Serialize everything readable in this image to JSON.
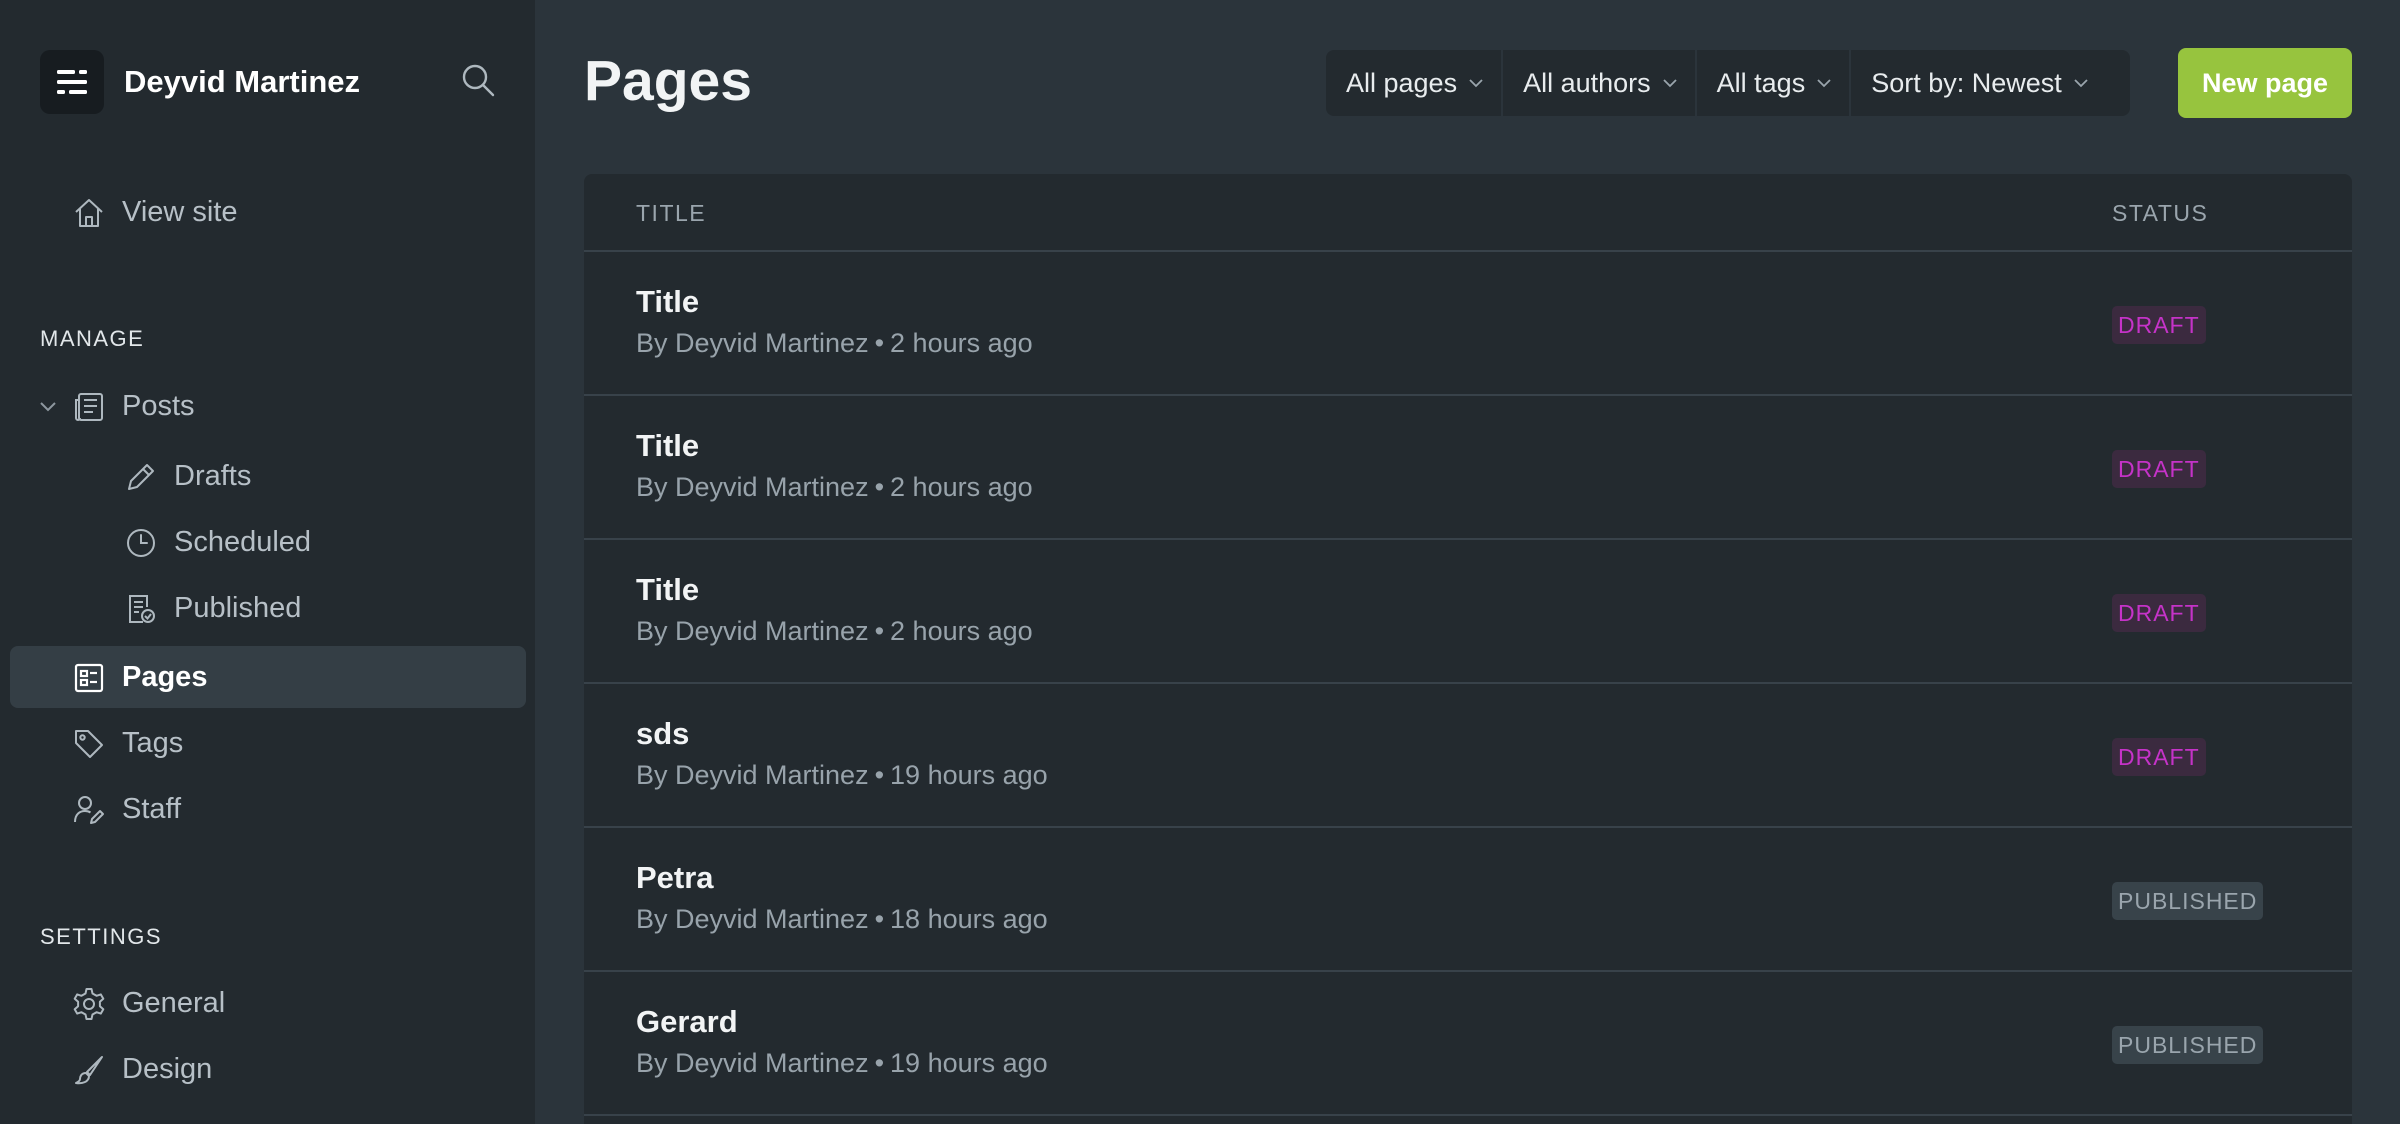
{
  "app": {
    "user_name": "Deyvid Martinez"
  },
  "sidebar": {
    "view_site": "View site",
    "manage_heading": "MANAGE",
    "posts": "Posts",
    "drafts": "Drafts",
    "scheduled": "Scheduled",
    "published": "Published",
    "pages": "Pages",
    "tags": "Tags",
    "staff": "Staff",
    "settings_heading": "SETTINGS",
    "general": "General",
    "design": "Design"
  },
  "header": {
    "title": "Pages",
    "filters": {
      "type": "All pages",
      "authors": "All authors",
      "tags": "All tags",
      "sort": "Sort by: Newest"
    },
    "new_button": "New page"
  },
  "table": {
    "col_title": "TITLE",
    "col_status": "STATUS",
    "rows": [
      {
        "title": "Title",
        "author": "By Deyvid Martinez",
        "time": "2 hours ago",
        "status": "DRAFT"
      },
      {
        "title": "Title",
        "author": "By Deyvid Martinez",
        "time": "2 hours ago",
        "status": "DRAFT"
      },
      {
        "title": "Title",
        "author": "By Deyvid Martinez",
        "time": "2 hours ago",
        "status": "DRAFT"
      },
      {
        "title": "sds",
        "author": "By Deyvid Martinez",
        "time": "19 hours ago",
        "status": "DRAFT"
      },
      {
        "title": "Petra",
        "author": "By Deyvid Martinez",
        "time": "18 hours ago",
        "status": "PUBLISHED"
      },
      {
        "title": "Gerard",
        "author": "By Deyvid Martinez",
        "time": "19 hours ago",
        "status": "PUBLISHED"
      }
    ],
    "meta_separator": "•"
  },
  "colors": {
    "accent": "#97c43e",
    "draft_text": "#c533c8",
    "draft_bg": "#3b2a3f",
    "published_text": "#9aa5ad",
    "published_bg": "#38434a",
    "sidebar_bg": "#232a2f",
    "main_bg": "#2b343b"
  },
  "icons": {
    "brand": "ghost-logo-icon",
    "search": "search-icon",
    "view_site": "home-icon",
    "posts": "posts-icon",
    "drafts": "pencil-icon",
    "scheduled": "clock-icon",
    "published": "published-check-icon",
    "pages": "pages-icon",
    "tags": "tag-icon",
    "staff": "staff-icon",
    "general": "gear-icon",
    "design": "brush-icon"
  }
}
